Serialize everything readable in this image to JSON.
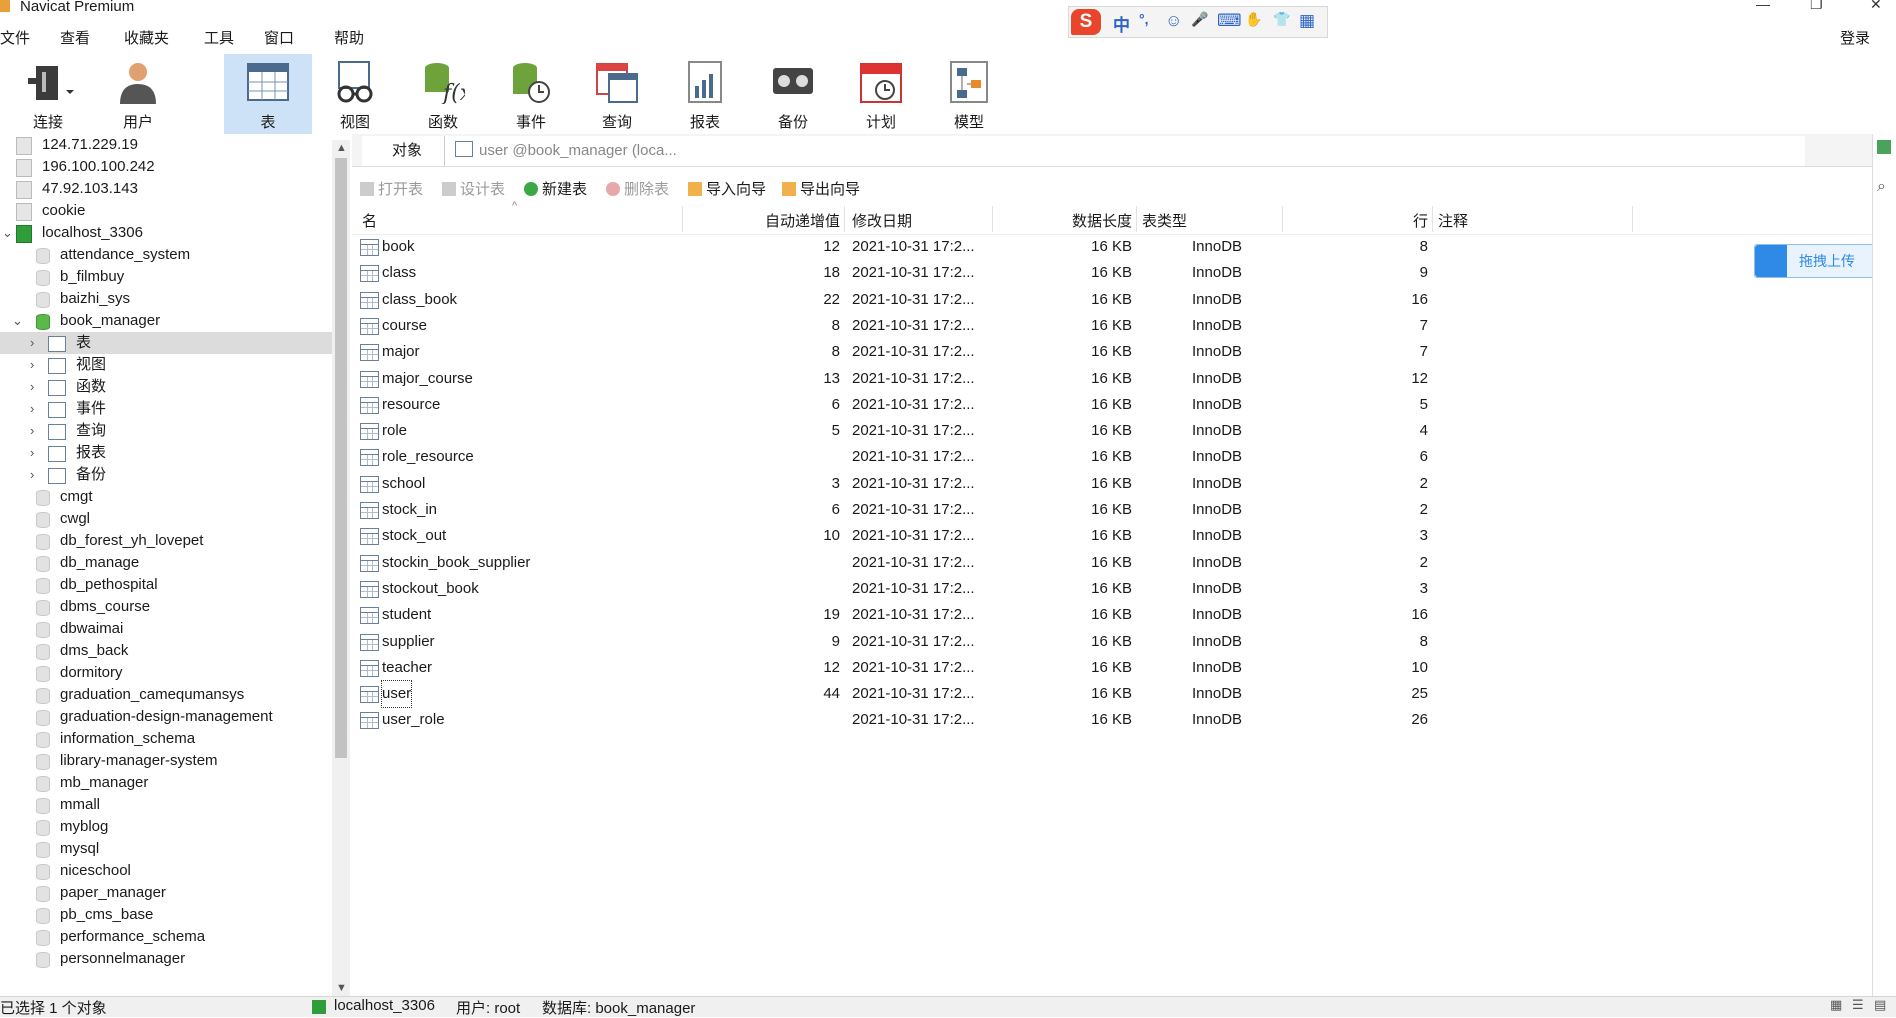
{
  "window": {
    "title": "Navicat Premium",
    "controls": [
      "—",
      "❐",
      "✕"
    ]
  },
  "ime": {
    "logo": "S",
    "mode": "中",
    "punct": "°,",
    "icons": [
      "☺",
      "🎤",
      "⌨",
      "✋",
      "👕",
      "▦"
    ]
  },
  "menu": [
    "文件",
    "查看",
    "收藏夹",
    "工具",
    "窗口",
    "帮助"
  ],
  "login_label": "登录",
  "toolbar": [
    {
      "label": "连接",
      "icon": "connection-plug-icon"
    },
    {
      "label": "用户",
      "icon": "user-icon"
    },
    {
      "label": "表",
      "icon": "table-icon",
      "active": true
    },
    {
      "label": "视图",
      "icon": "view-glasses-icon"
    },
    {
      "label": "函数",
      "icon": "function-icon"
    },
    {
      "label": "事件",
      "icon": "event-clock-icon"
    },
    {
      "label": "查询",
      "icon": "query-icon"
    },
    {
      "label": "报表",
      "icon": "report-icon"
    },
    {
      "label": "备份",
      "icon": "backup-tape-icon"
    },
    {
      "label": "计划",
      "icon": "schedule-calendar-icon"
    },
    {
      "label": "模型",
      "icon": "model-icon"
    }
  ],
  "sidebar": {
    "connections_top": [
      "124.71.229.19",
      "196.100.100.242",
      "47.92.103.143",
      "cookie"
    ],
    "open_connection": "localhost_3306",
    "databases_before": [
      "attendance_system",
      "b_filmbuy",
      "baizhi_sys"
    ],
    "open_database": "book_manager",
    "db_children": [
      {
        "label": "表",
        "icon": "table-icon",
        "selected": true
      },
      {
        "label": "视图",
        "icon": "view-glasses-icon"
      },
      {
        "label": "函数",
        "icon": "function-icon"
      },
      {
        "label": "事件",
        "icon": "event-clock-icon"
      },
      {
        "label": "查询",
        "icon": "query-icon"
      },
      {
        "label": "报表",
        "icon": "report-icon"
      },
      {
        "label": "备份",
        "icon": "backup-tape-icon"
      }
    ],
    "databases_after": [
      "cmgt",
      "cwgl",
      "db_forest_yh_lovepet",
      "db_manage",
      "db_pethospital",
      "dbms_course",
      "dbwaimai",
      "dms_back",
      "dormitory",
      "graduation_camequmansys",
      "graduation-design-management",
      "information_schema",
      "library-manager-system",
      "mb_manager",
      "mmall",
      "myblog",
      "mysql",
      "niceschool",
      "paper_manager",
      "pb_cms_base",
      "performance_schema",
      "personnelmanager"
    ]
  },
  "tabs": {
    "objects": "对象",
    "user_tab": "user @book_manager (loca..."
  },
  "actions": [
    {
      "label": "打开表",
      "disabled": true
    },
    {
      "label": "设计表",
      "disabled": true
    },
    {
      "label": "新建表",
      "disabled": false
    },
    {
      "label": "删除表",
      "disabled": true
    },
    {
      "label": "导入向导",
      "disabled": false
    },
    {
      "label": "导出向导",
      "disabled": false
    }
  ],
  "columns": {
    "name": "名",
    "auto_inc": "自动递增值",
    "modified": "修改日期",
    "data_len": "数据长度",
    "engine": "表类型",
    "rows": "行",
    "comment": "注释"
  },
  "tables": [
    {
      "name": "book",
      "auto_inc": "12",
      "modified": "2021-10-31 17:2...",
      "size": "16 KB",
      "engine": "InnoDB",
      "rows": "8"
    },
    {
      "name": "class",
      "auto_inc": "18",
      "modified": "2021-10-31 17:2...",
      "size": "16 KB",
      "engine": "InnoDB",
      "rows": "9"
    },
    {
      "name": "class_book",
      "auto_inc": "22",
      "modified": "2021-10-31 17:2...",
      "size": "16 KB",
      "engine": "InnoDB",
      "rows": "16"
    },
    {
      "name": "course",
      "auto_inc": "8",
      "modified": "2021-10-31 17:2...",
      "size": "16 KB",
      "engine": "InnoDB",
      "rows": "7"
    },
    {
      "name": "major",
      "auto_inc": "8",
      "modified": "2021-10-31 17:2...",
      "size": "16 KB",
      "engine": "InnoDB",
      "rows": "7"
    },
    {
      "name": "major_course",
      "auto_inc": "13",
      "modified": "2021-10-31 17:2...",
      "size": "16 KB",
      "engine": "InnoDB",
      "rows": "12"
    },
    {
      "name": "resource",
      "auto_inc": "6",
      "modified": "2021-10-31 17:2...",
      "size": "16 KB",
      "engine": "InnoDB",
      "rows": "5"
    },
    {
      "name": "role",
      "auto_inc": "5",
      "modified": "2021-10-31 17:2...",
      "size": "16 KB",
      "engine": "InnoDB",
      "rows": "4"
    },
    {
      "name": "role_resource",
      "auto_inc": "",
      "modified": "2021-10-31 17:2...",
      "size": "16 KB",
      "engine": "InnoDB",
      "rows": "6"
    },
    {
      "name": "school",
      "auto_inc": "3",
      "modified": "2021-10-31 17:2...",
      "size": "16 KB",
      "engine": "InnoDB",
      "rows": "2"
    },
    {
      "name": "stock_in",
      "auto_inc": "6",
      "modified": "2021-10-31 17:2...",
      "size": "16 KB",
      "engine": "InnoDB",
      "rows": "2"
    },
    {
      "name": "stock_out",
      "auto_inc": "10",
      "modified": "2021-10-31 17:2...",
      "size": "16 KB",
      "engine": "InnoDB",
      "rows": "3"
    },
    {
      "name": "stockin_book_supplier",
      "auto_inc": "",
      "modified": "2021-10-31 17:2...",
      "size": "16 KB",
      "engine": "InnoDB",
      "rows": "2"
    },
    {
      "name": "stockout_book",
      "auto_inc": "",
      "modified": "2021-10-31 17:2...",
      "size": "16 KB",
      "engine": "InnoDB",
      "rows": "3"
    },
    {
      "name": "student",
      "auto_inc": "19",
      "modified": "2021-10-31 17:2...",
      "size": "16 KB",
      "engine": "InnoDB",
      "rows": "16"
    },
    {
      "name": "supplier",
      "auto_inc": "9",
      "modified": "2021-10-31 17:2...",
      "size": "16 KB",
      "engine": "InnoDB",
      "rows": "8"
    },
    {
      "name": "teacher",
      "auto_inc": "12",
      "modified": "2021-10-31 17:2...",
      "size": "16 KB",
      "engine": "InnoDB",
      "rows": "10"
    },
    {
      "name": "user",
      "auto_inc": "44",
      "modified": "2021-10-31 17:2...",
      "size": "16 KB",
      "engine": "InnoDB",
      "rows": "25",
      "selected": true
    },
    {
      "name": "user_role",
      "auto_inc": "",
      "modified": "2021-10-31 17:2...",
      "size": "16 KB",
      "engine": "InnoDB",
      "rows": "26"
    }
  ],
  "upload_button": "拖拽上传",
  "status": {
    "selection": "已选择 1 个对象",
    "connection": "localhost_3306",
    "user": "用户: root",
    "database": "数据库: book_manager"
  },
  "colors": {
    "accent": "#cde2f6",
    "connection_green": "#2f9e3a",
    "upload_blue": "#2e8ae6"
  }
}
